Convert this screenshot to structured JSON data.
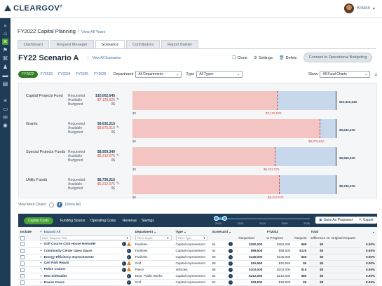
{
  "brand": "CLEARGOV",
  "user_name": "Kristen",
  "header": {
    "plan": "FY2022 Capital Planning",
    "view_all": "View All Years"
  },
  "tabs": [
    "Dashboard",
    "Request Manager",
    "Scenarios",
    "Contributors",
    "Report Builder"
  ],
  "active_tab": 2,
  "scenario": {
    "title": "FY22 Scenario A",
    "view_all": "View All Scenarios"
  },
  "actions": {
    "clone": "Clone",
    "settings": "Settings",
    "delete": "Delete",
    "connect": "Connect to Operational Budgeting"
  },
  "years": [
    "FY2022",
    "FY2023",
    "FY2024",
    "FY2025",
    "FY2026"
  ],
  "filters": {
    "department_label": "Department",
    "department_value": "All Departments",
    "type_label": "Type",
    "type_value": "All Types",
    "show_label": "Show",
    "show_value": "All Fund Charts"
  },
  "funds": [
    {
      "name": "Capital Projects Fund",
      "requested": "$10,002,645",
      "available": "$7,125,525",
      "budgeted": "0$",
      "req_label": "$10,002,645",
      "av_label": "$7,125,525",
      "zero": "$0",
      "req_ratio": 1.0,
      "av_ratio": 0.71
    },
    {
      "name": "Grants",
      "requested": "$9,632,215",
      "available": "$8,875,610",
      "budgeted": "0$",
      "req_label": "$9,632,215",
      "av_label": "$8,875,610",
      "zero": "$0",
      "req_ratio": 1.0,
      "av_ratio": 0.92
    },
    {
      "name": "Special Projects Funds",
      "requested": "$8,959,340",
      "available": "$6,312,075",
      "budgeted": "0$",
      "req_label": "$8,959,340",
      "av_label": "$6,312,075",
      "zero": "$0",
      "req_ratio": 1.0,
      "av_ratio": 0.7
    },
    {
      "name": "Utility Funds",
      "requested": "$8,736,215",
      "available": "$6,312,075",
      "budgeted": "0$",
      "req_label": "$8,736,215",
      "av_label": "$6,312,075",
      "zero": "$0",
      "req_ratio": 1.0,
      "av_ratio": 0.72
    }
  ],
  "fund_row_labels": {
    "requested": "Requested",
    "available": "Available",
    "budgeted": "Budgeted"
  },
  "view_more": {
    "label": "View More Charts",
    "show_all": "(Show All)"
  },
  "grid_tabs": [
    "Capital Costs",
    "Funding Source",
    "Operating Costs",
    "Revenue",
    "Savings"
  ],
  "timeline_years": [
    "2022",
    "2023",
    "2024",
    "2025",
    "2026"
  ],
  "grid_buttons": {
    "save": "Save As Proposed",
    "export": "Export"
  },
  "columns": {
    "include": "Include",
    "expand": "Expand All",
    "department": "Department",
    "type": "Type",
    "scorecard": "Scorecard",
    "fy": "FY2022",
    "requested": "Requested",
    "in_progress": "In Progress",
    "request_short": "Request",
    "total": "Total",
    "diff": "Difference vs. Original Request"
  },
  "filter_placeholders": {
    "title": "Filter Request Title",
    "dept": "Filter Depts",
    "type": "Filter Type"
  },
  "rows": [
    {
      "name": "Golf Course Club House Remodel",
      "warn": true,
      "dept": "Facilities",
      "type": "Capital Improvement",
      "score": "64",
      "requested": "$350,000",
      "progress": "$350,000",
      "partial": "$89",
      "total": "$0",
      "diff": "0.00%"
    },
    {
      "name": "Community Center Open Space",
      "warn": false,
      "dept": "Facilities",
      "type": "Capital Improvement",
      "score": "62",
      "requested": "$98,500",
      "progress": "$98,500",
      "partial": "$125",
      "total": "$0",
      "diff": "0.00%"
    },
    {
      "name": "Energy Efficiency Improvements",
      "warn": false,
      "dept": "Facilities",
      "type": "Capital Improvement",
      "score": "60",
      "requested": "$145,000",
      "progress": "$145,000",
      "partial": "$65",
      "total": "$0",
      "diff": "0.00%"
    },
    {
      "name": "Cart Path Repair",
      "warn": true,
      "dept": "Golf",
      "type": "Capital Improvement",
      "score": "58",
      "requested": "$15,550",
      "progress": "$15,550",
      "partial": "$6",
      "total": "$0",
      "diff": "0.00%"
    },
    {
      "name": "Police Cruiser",
      "warn": true,
      "dept": "Police",
      "type": "Vehicles",
      "score": "56",
      "requested": "$102,000",
      "progress": "$102,000",
      "partial": "$16",
      "total": "$0",
      "diff": "0.00%"
    },
    {
      "name": "New Sidewalks",
      "warn": false,
      "dept": "Dept. Public Works",
      "type": "Capital Improvement",
      "score": "52",
      "requested": "$212,000",
      "progress": "$212,000",
      "partial": "$89",
      "total": "$0",
      "diff": "0.00%"
    },
    {
      "name": "Dowse Fence",
      "warn": false,
      "dept": "Golf",
      "type": "Capital Improvement",
      "score": "52",
      "requested": "$18,500",
      "progress": "$18,500",
      "partial": "$8",
      "total": "$0",
      "diff": "0.00%"
    }
  ],
  "colors": {
    "navy": "#1f3c56",
    "green": "#4aa236",
    "red": "#d4453f",
    "blue_bar": "#c7d8ed",
    "red_bar": "#f3c4c1"
  }
}
